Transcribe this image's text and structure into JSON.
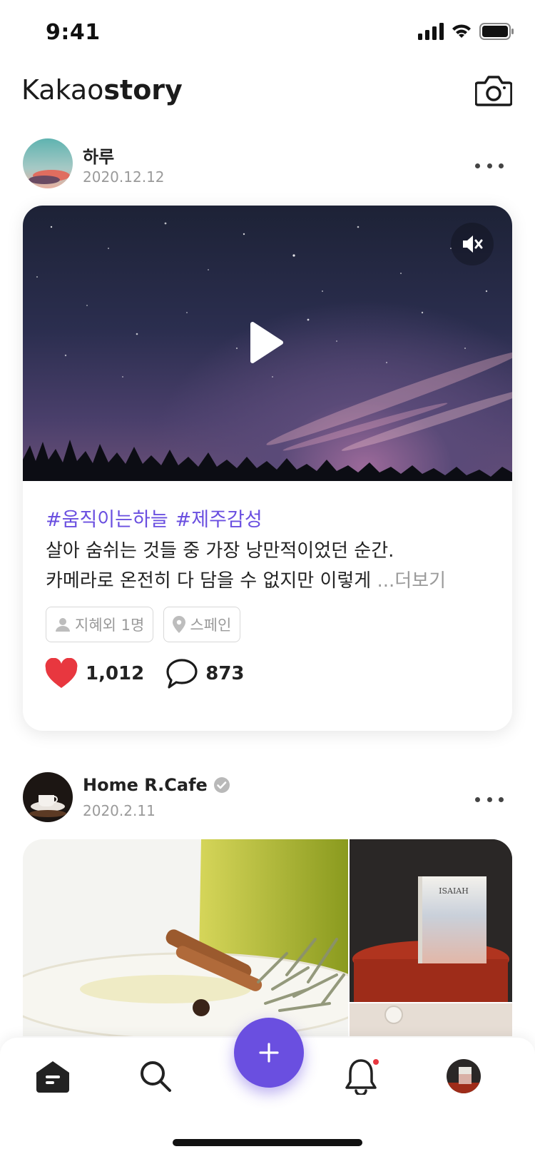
{
  "status_bar": {
    "time": "9:41"
  },
  "header": {
    "title_light": "Kakao",
    "title_bold": "story",
    "camera_icon": "camera-icon"
  },
  "posts": [
    {
      "author": "하루",
      "date": "2020.12.12",
      "media": "video",
      "hashtags": [
        "#움직이는하늘",
        "#제주감성"
      ],
      "caption_line1": "살아 숨쉬는 것들 중 가장 낭만적이었던 순간.",
      "caption_line2": "카메라로 온전히 다 담을 수 없지만 이렇게 ",
      "more_label": "...더보기",
      "tag_people": "지혜외 1명",
      "tag_place": "스페인",
      "likes": "1,012",
      "comments": "873"
    },
    {
      "author": "Home R.Cafe",
      "verified": true,
      "date": "2020.2.11",
      "book_text": "ISAIAH"
    }
  ],
  "colors": {
    "accent": "#6a4fe0",
    "like": "#e8373f",
    "muted": "#9a9a9a"
  },
  "nav": {
    "items": [
      "home-icon",
      "search-icon",
      "add-icon",
      "bell-icon",
      "profile-avatar"
    ],
    "has_notification": true
  }
}
